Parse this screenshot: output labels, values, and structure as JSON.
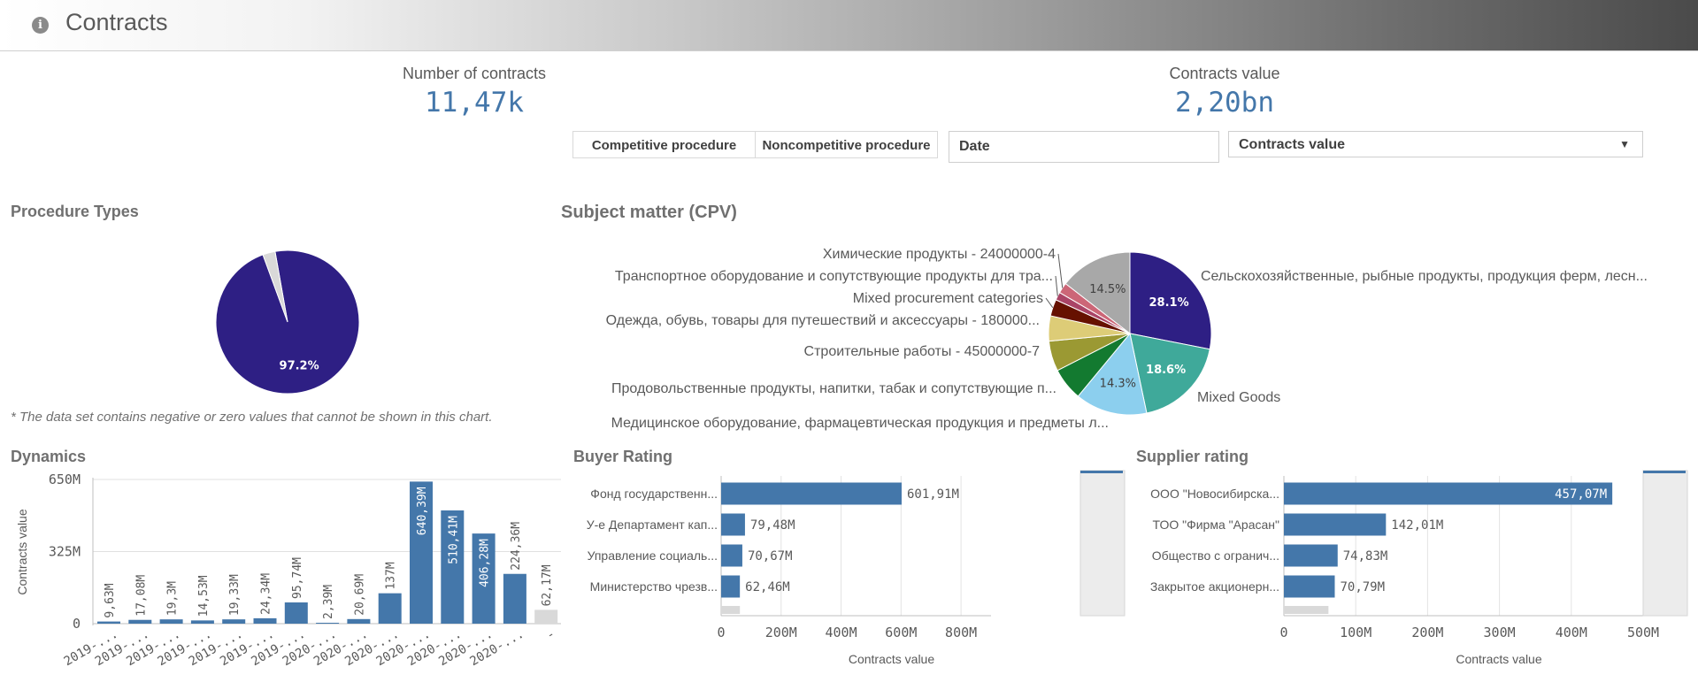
{
  "header": {
    "title": "Contracts",
    "info_icon": "info-icon"
  },
  "kpis": [
    {
      "label": "Number of contracts",
      "value": "11,47k"
    },
    {
      "label": "Contracts value",
      "value": "2,20bn"
    }
  ],
  "filters": {
    "procedure_buttons": [
      "Competitive procedure",
      "Noncompetitive procedure"
    ],
    "date_label": "Date",
    "measure_select": {
      "selected": "Contracts value",
      "icon": "chevron-down-icon"
    }
  },
  "colors": {
    "accent": "#4477aa",
    "pie_main": "#2e1f84",
    "header_grey": "#595959"
  },
  "procedure_types": {
    "title": "Procedure Types",
    "note": "* The data set contains negative or zero values that cannot be shown in this chart.",
    "chart_data": {
      "type": "pie",
      "slices": [
        {
          "value": 97.2,
          "label": "97.2%",
          "color": "#2e1f84"
        },
        {
          "value": 2.8,
          "label": "",
          "color": "#d9d9d9"
        }
      ]
    }
  },
  "subject_matter": {
    "title": "Subject matter (CPV)",
    "chart_data": {
      "type": "pie",
      "slices": [
        {
          "name": "Сельскохозяйственные, рыбные продукты, продукция ферм, лесн...",
          "value": 28.1,
          "pct_label": "28.1%",
          "color": "#2e1f84"
        },
        {
          "name": "Mixed Goods",
          "value": 18.6,
          "pct_label": "18.6%",
          "color": "#3fa99a"
        },
        {
          "name": "Медицинское оборудование, фармацевтическая продукция и предметы л...",
          "value": 14.3,
          "pct_label": "14.3%",
          "color": "#8ccfee"
        },
        {
          "name": "Продовольственные продукты, напитки, табак и сопутствующие п...",
          "value": 6.5,
          "pct_label": "",
          "color": "#137a30"
        },
        {
          "name": "Строительные работы - 45000000-7",
          "value": 6.0,
          "pct_label": "",
          "color": "#9b9933"
        },
        {
          "name": "Одежда, обувь, товары для путешествий и аксессуары - 180000...",
          "value": 5.0,
          "pct_label": "",
          "color": "#ddcc77"
        },
        {
          "name": "Mixed procurement categories",
          "value": 3.3,
          "pct_label": "",
          "color": "#661100"
        },
        {
          "name": "Транспортное оборудование и сопутствующие продукты для тра...",
          "value": 1.6,
          "pct_label": "",
          "color": "#aa4466"
        },
        {
          "name": "Химические продукты - 24000000-4",
          "value": 2.1,
          "pct_label": "",
          "color": "#cc6677"
        },
        {
          "name": "",
          "value": 14.5,
          "pct_label": "14.5%",
          "color": "#a8a8a8"
        }
      ]
    }
  },
  "dynamics": {
    "title": "Dynamics",
    "chart_data": {
      "type": "bar",
      "ylabel": "Contracts value",
      "xlabel": "",
      "ylim": [
        0,
        650
      ],
      "ytick_labels": [
        "650M",
        "325M",
        "0"
      ],
      "ytick_values": [
        650,
        325,
        0
      ],
      "categories": [
        "2019-...",
        "2019-...",
        "2019-...",
        "2019-...",
        "2019-...",
        "2019-...",
        "2019-...",
        "2020-...",
        "2020-...",
        "2020-...",
        "2020-...",
        "2020-...",
        "2020-...",
        "2020-...",
        "-"
      ],
      "values": [
        9.63,
        17.08,
        19.3,
        14.53,
        19.33,
        24.34,
        95.74,
        2.39,
        20.69,
        137,
        640.39,
        510.41,
        406.28,
        224.36,
        62.17
      ],
      "value_labels": [
        "9,63M",
        "17,08M",
        "19,3M",
        "14,53M",
        "19,33M",
        "24,34M",
        "95,74M",
        "2,39M",
        "20,69M",
        "137M",
        "640,39M",
        "510,41M",
        "406,28M",
        "224,36M",
        "62,17M"
      ],
      "bar_color": "#4477aa",
      "other_color": "#d9d9d9"
    }
  },
  "buyer_rating": {
    "title": "Buyer Rating",
    "chart_data": {
      "type": "bar",
      "orientation": "horizontal",
      "xlabel": "Contracts value",
      "xlim": [
        0,
        900
      ],
      "xtick_labels": [
        "0",
        "200M",
        "400M",
        "600M",
        "800M"
      ],
      "xtick_values": [
        0,
        200,
        400,
        600,
        800
      ],
      "categories": [
        "Фонд государственн...",
        "У-е Департамент кап...",
        "Управление социаль...",
        "Министерство чрезв..."
      ],
      "values": [
        601.91,
        79.48,
        70.67,
        62.46
      ],
      "value_labels": [
        "601,91M",
        "79,48M",
        "70,67M",
        "62,46M"
      ],
      "others_value": 62.46
    }
  },
  "supplier_rating": {
    "title": "Supplier rating",
    "chart_data": {
      "type": "bar",
      "orientation": "horizontal",
      "xlabel": "Contracts value",
      "xlim": [
        0,
        500
      ],
      "xtick_labels": [
        "0",
        "100M",
        "200M",
        "300M",
        "400M",
        "500M"
      ],
      "xtick_values": [
        0,
        100,
        200,
        300,
        400,
        500
      ],
      "categories": [
        "ООО \"Новосибирска...",
        "ТОО \"Фирма \"Арасан\"",
        "Общество с огранич...",
        "Закрытое акционерн..."
      ],
      "values": [
        457.07,
        142.01,
        74.83,
        70.79
      ],
      "value_labels": [
        "457,07M",
        "142,01M",
        "74,83M",
        "70,79M"
      ],
      "others_value": 62
    }
  }
}
